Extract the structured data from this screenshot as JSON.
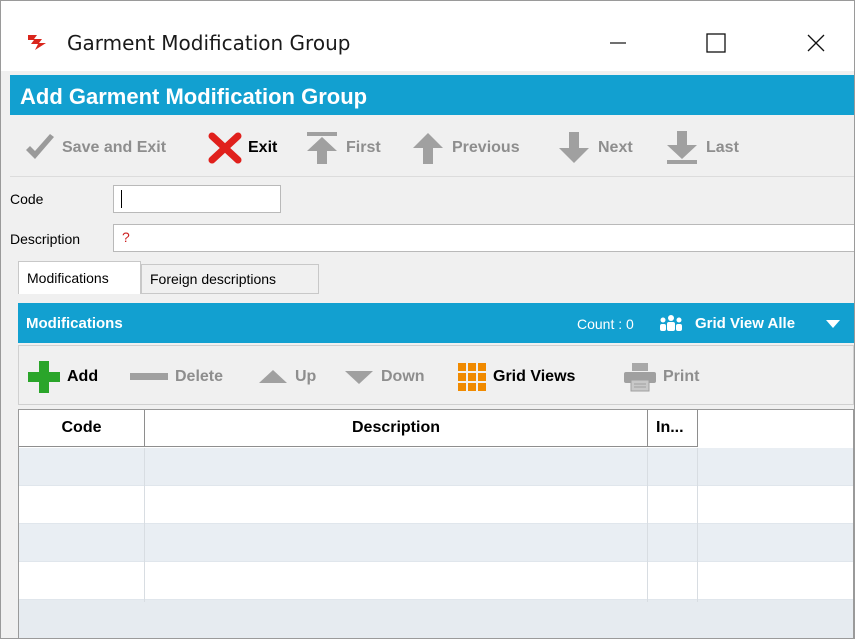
{
  "window": {
    "title": "Garment Modification Group"
  },
  "header": {
    "title": "Add Garment Modification Group"
  },
  "toolbar": {
    "save_exit": "Save and Exit",
    "exit": "Exit",
    "first": "First",
    "previous": "Previous",
    "next": "Next",
    "last": "Last"
  },
  "form": {
    "code_label": "Code",
    "code_value": "",
    "description_label": "Description",
    "description_value": "?"
  },
  "tabs": [
    {
      "label": "Modifications",
      "selected": true
    },
    {
      "label": "Foreign descriptions",
      "selected": false
    }
  ],
  "modifications": {
    "title": "Modifications",
    "count": "Count : 0",
    "grid_view": "Grid View Alle",
    "toolbar": {
      "add": "Add",
      "delete": "Delete",
      "up": "Up",
      "down": "Down",
      "grid_views": "Grid Views",
      "print": "Print"
    },
    "columns": [
      "Code",
      "Description",
      "In..."
    ],
    "rows": []
  },
  "colors": {
    "accent_blue": "#12a0d0",
    "add_green": "#2aa52a",
    "exit_red": "#e0201c",
    "grid_orange": "#f08a00",
    "title_icon_red": "#d9251c"
  },
  "icons": {
    "app": "app-logo-icon",
    "save": "check-icon",
    "exit": "x-icon",
    "first": "arrow-up-bar-icon",
    "previous": "arrow-up-icon",
    "next": "arrow-down-icon",
    "last": "arrow-down-bar-icon",
    "add": "plus-icon",
    "delete": "minus-icon",
    "up": "triangle-up-icon",
    "down": "triangle-down-icon",
    "grid_views": "grid-icon",
    "print": "printer-icon",
    "people": "people-icon",
    "chevron": "chevron-down-icon"
  }
}
